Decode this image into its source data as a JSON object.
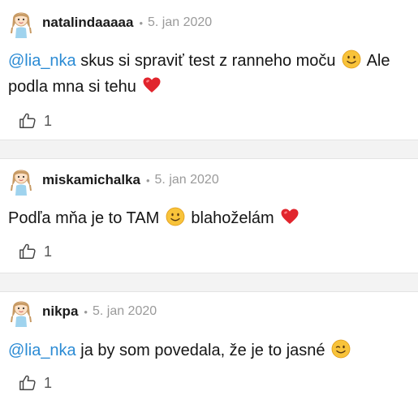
{
  "comments": [
    {
      "user": "natalindaaaaa",
      "date": "5. jan 2020",
      "mention": "@lia_nka",
      "text_a": " skus si spraviť test z ranneho moču ",
      "text_b": " Ale podla mna si tehu ",
      "emoji_a": "smile-emoji",
      "emoji_b": "heart-emoji",
      "likes": "1"
    },
    {
      "user": "miskamichalka",
      "date": "5. jan 2020",
      "text_a": "Podľa mňa je to TAM ",
      "text_b": " blahoželám ",
      "emoji_a": "smile-emoji",
      "emoji_b": "heart-emoji",
      "likes": "1"
    },
    {
      "user": "nikpa",
      "date": "5. jan 2020",
      "mention": "@lia_nka",
      "text_a": " ja by som povedala, že je to jasné ",
      "emoji_a": "wink-emoji",
      "likes": "1"
    }
  ],
  "colors": {
    "mention": "#2b8bd4",
    "meta": "#9a9a9a",
    "separator": "#f3f3f3"
  }
}
